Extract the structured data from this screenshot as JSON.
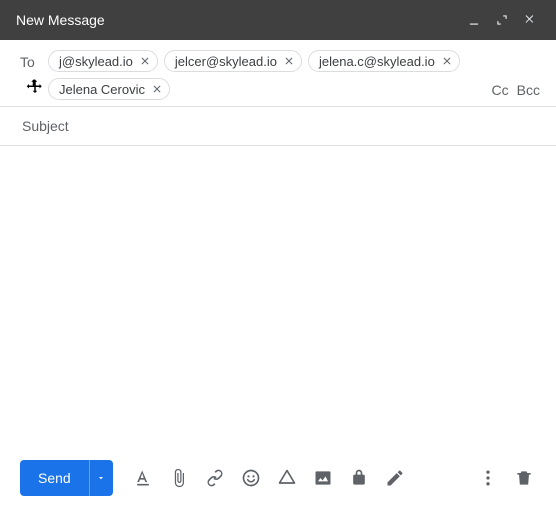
{
  "window": {
    "title": "New Message"
  },
  "to": {
    "label": "To",
    "cc_label": "Cc",
    "bcc_label": "Bcc",
    "chips": [
      "j@skylead.io",
      "jelcer@skylead.io",
      "jelena.c@skylead.io",
      "Jelena Cerovic"
    ]
  },
  "subject": {
    "placeholder": "Subject",
    "value": ""
  },
  "toolbar": {
    "send_label": "Send"
  },
  "colors": {
    "primary": "#1a73e8",
    "titlebar": "#404040"
  }
}
